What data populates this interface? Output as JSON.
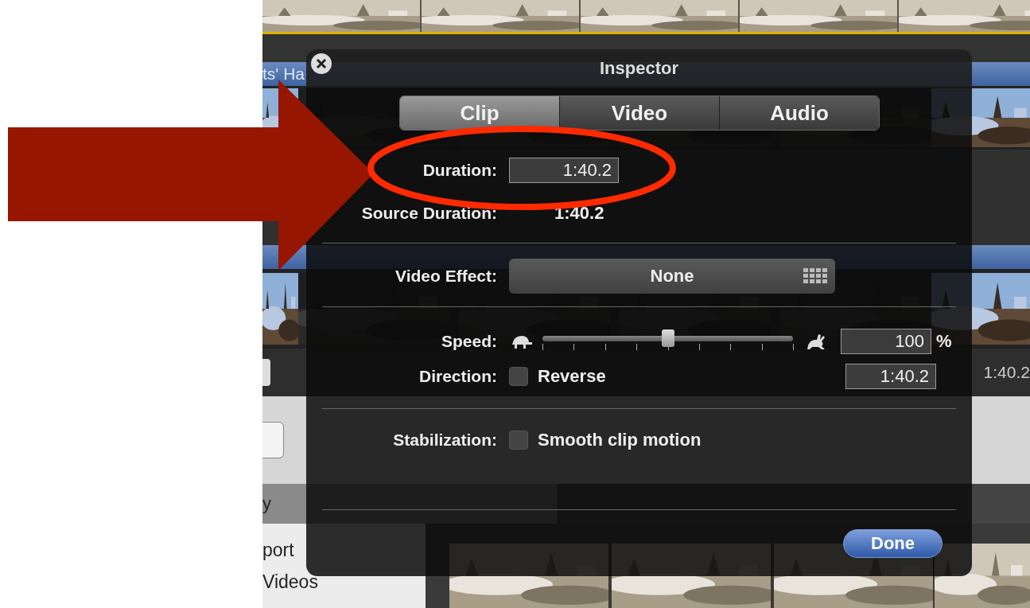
{
  "background": {
    "clip_title": "ts' Ha",
    "time": "1:40.2",
    "sidebar_header": "y",
    "sidebar_items": [
      "port",
      "Videos"
    ]
  },
  "inspector": {
    "title": "Inspector",
    "tabs": [
      {
        "label": "Clip",
        "selected": true
      },
      {
        "label": "Video",
        "selected": false
      },
      {
        "label": "Audio",
        "selected": false
      }
    ],
    "duration": {
      "label": "Duration:",
      "value": "1:40.2"
    },
    "source_duration": {
      "label": "Source Duration:",
      "value": "1:40.2"
    },
    "video_effect": {
      "label": "Video Effect:",
      "value": "None"
    },
    "speed": {
      "label": "Speed:",
      "level": 0.5,
      "value": "100",
      "unit": "%"
    },
    "direction": {
      "label": "Direction:",
      "checkbox_label": "Reverse",
      "checked": false,
      "value": "1:40.2"
    },
    "stabilization": {
      "label": "Stabilization:",
      "checkbox_label": "Smooth clip motion",
      "checked": false
    },
    "done_button": "Done"
  }
}
